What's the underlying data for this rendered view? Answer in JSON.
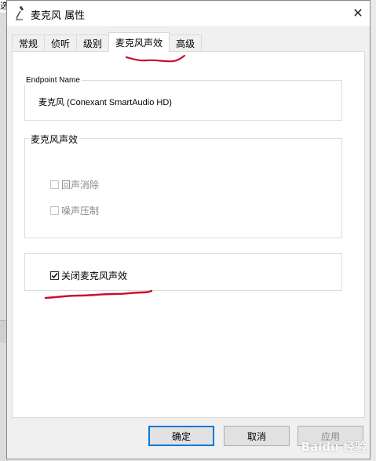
{
  "window": {
    "title": "麦克风 属性",
    "close_glyph": "✕"
  },
  "tabs": [
    {
      "label": "常规",
      "active": false
    },
    {
      "label": "侦听",
      "active": false
    },
    {
      "label": "级别",
      "active": false
    },
    {
      "label": "麦克风声效",
      "active": true
    },
    {
      "label": "高级",
      "active": false
    }
  ],
  "endpoint": {
    "label": "Endpoint Name",
    "value": "麦克风 (Conexant SmartAudio HD)"
  },
  "effects": {
    "group_label": "麦克风声效",
    "options": [
      {
        "label": "回声消除",
        "checked": false,
        "enabled": false
      },
      {
        "label": "噪声压制",
        "checked": false,
        "enabled": false
      }
    ]
  },
  "disable_effects": {
    "label": "关闭麦克风声效",
    "checked": true
  },
  "buttons": {
    "ok": "确定",
    "cancel": "取消",
    "apply": "应用"
  },
  "watermark": "Baidu 经验",
  "background_fragment": {
    "top_char": "选"
  },
  "colors": {
    "annotation_red": "#c8102e",
    "focus_blue": "#0078d7",
    "disabled_text": "#8a8a8a"
  },
  "icons": {
    "title_icon": "microphone-icon",
    "close_icon": "close-icon",
    "checkbox_check": "checkmark-icon"
  }
}
